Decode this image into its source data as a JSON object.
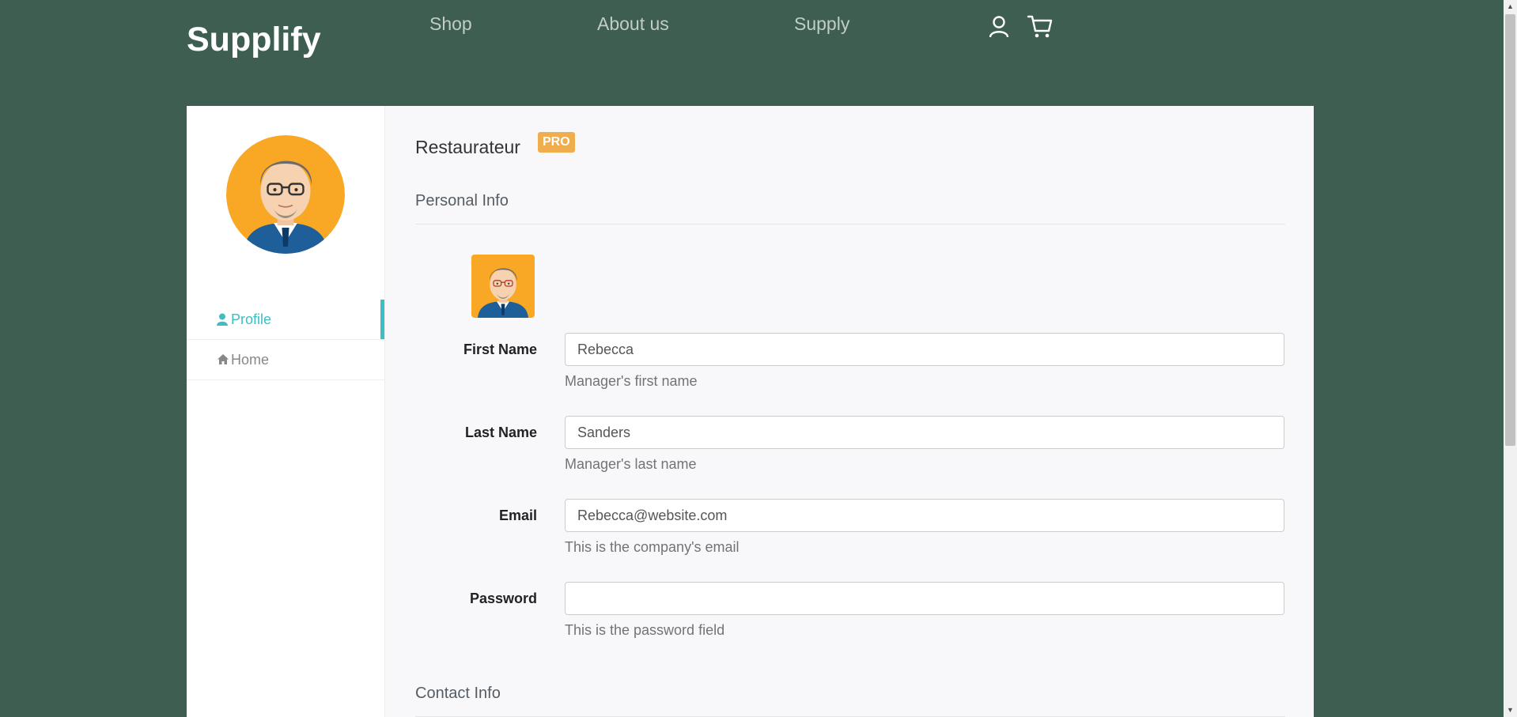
{
  "header": {
    "brand": "Supplify",
    "nav": [
      {
        "label": "Shop"
      },
      {
        "label": "About us"
      },
      {
        "label": "Supply"
      }
    ],
    "icons": [
      "user-icon",
      "cart-icon"
    ]
  },
  "sidebar": {
    "items": [
      {
        "label": "Profile",
        "icon": "user-icon",
        "active": true
      },
      {
        "label": "Home",
        "icon": "home-icon",
        "active": false
      }
    ]
  },
  "profile": {
    "role": "Restaurateur",
    "badge": "PRO"
  },
  "sections": {
    "personal": "Personal Info",
    "contact": "Contact Info"
  },
  "form": {
    "first_name": {
      "label": "First Name",
      "value": "Rebecca",
      "help": "Manager's first name"
    },
    "last_name": {
      "label": "Last Name",
      "value": "Sanders",
      "help": "Manager's last name"
    },
    "email": {
      "label": "Email",
      "value": "Rebecca@website.com",
      "help": "This is the company's email"
    },
    "password": {
      "label": "Password",
      "value": "",
      "help": "This is the password field"
    }
  },
  "colors": {
    "header_bg": "#3d5e51",
    "accent": "#3dbfc1",
    "badge": "#f0ad4e",
    "avatar_bg": "#f9a825"
  }
}
